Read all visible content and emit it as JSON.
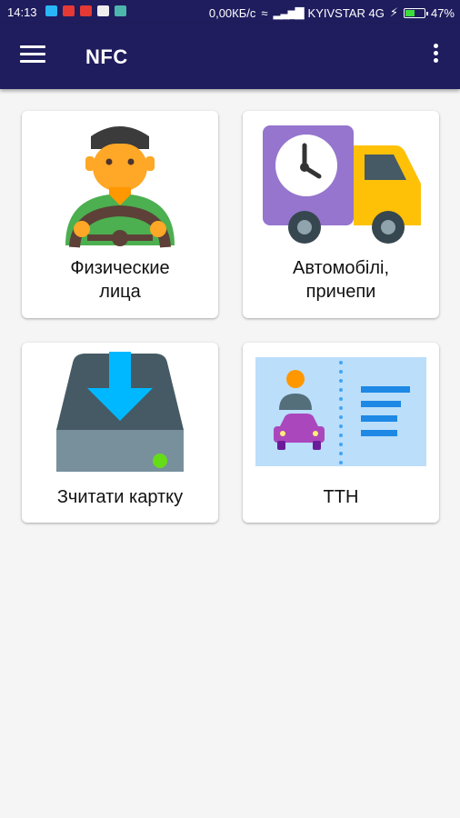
{
  "status_bar": {
    "time": "14:13",
    "speed": "0,00КБ/с",
    "carrier": "KYIVSTAR 4G",
    "battery": "47%",
    "battery_level": 0.47
  },
  "app_bar": {
    "title": "NFC",
    "menu_icon": "hamburger-menu-icon",
    "overflow_icon": "more-vert-icon",
    "color": "#1f1d5e"
  },
  "cards": [
    {
      "label_line1": "Физические",
      "label_line2": "лица",
      "icon": "driver-icon"
    },
    {
      "label_line1": "Автомобілі,",
      "label_line2": "причепи",
      "icon": "delivery-truck-icon"
    },
    {
      "label_line1": "Зчитати картку",
      "icon": "download-drive-icon"
    },
    {
      "label_line1": "ТТН",
      "icon": "waybill-document-icon"
    }
  ]
}
